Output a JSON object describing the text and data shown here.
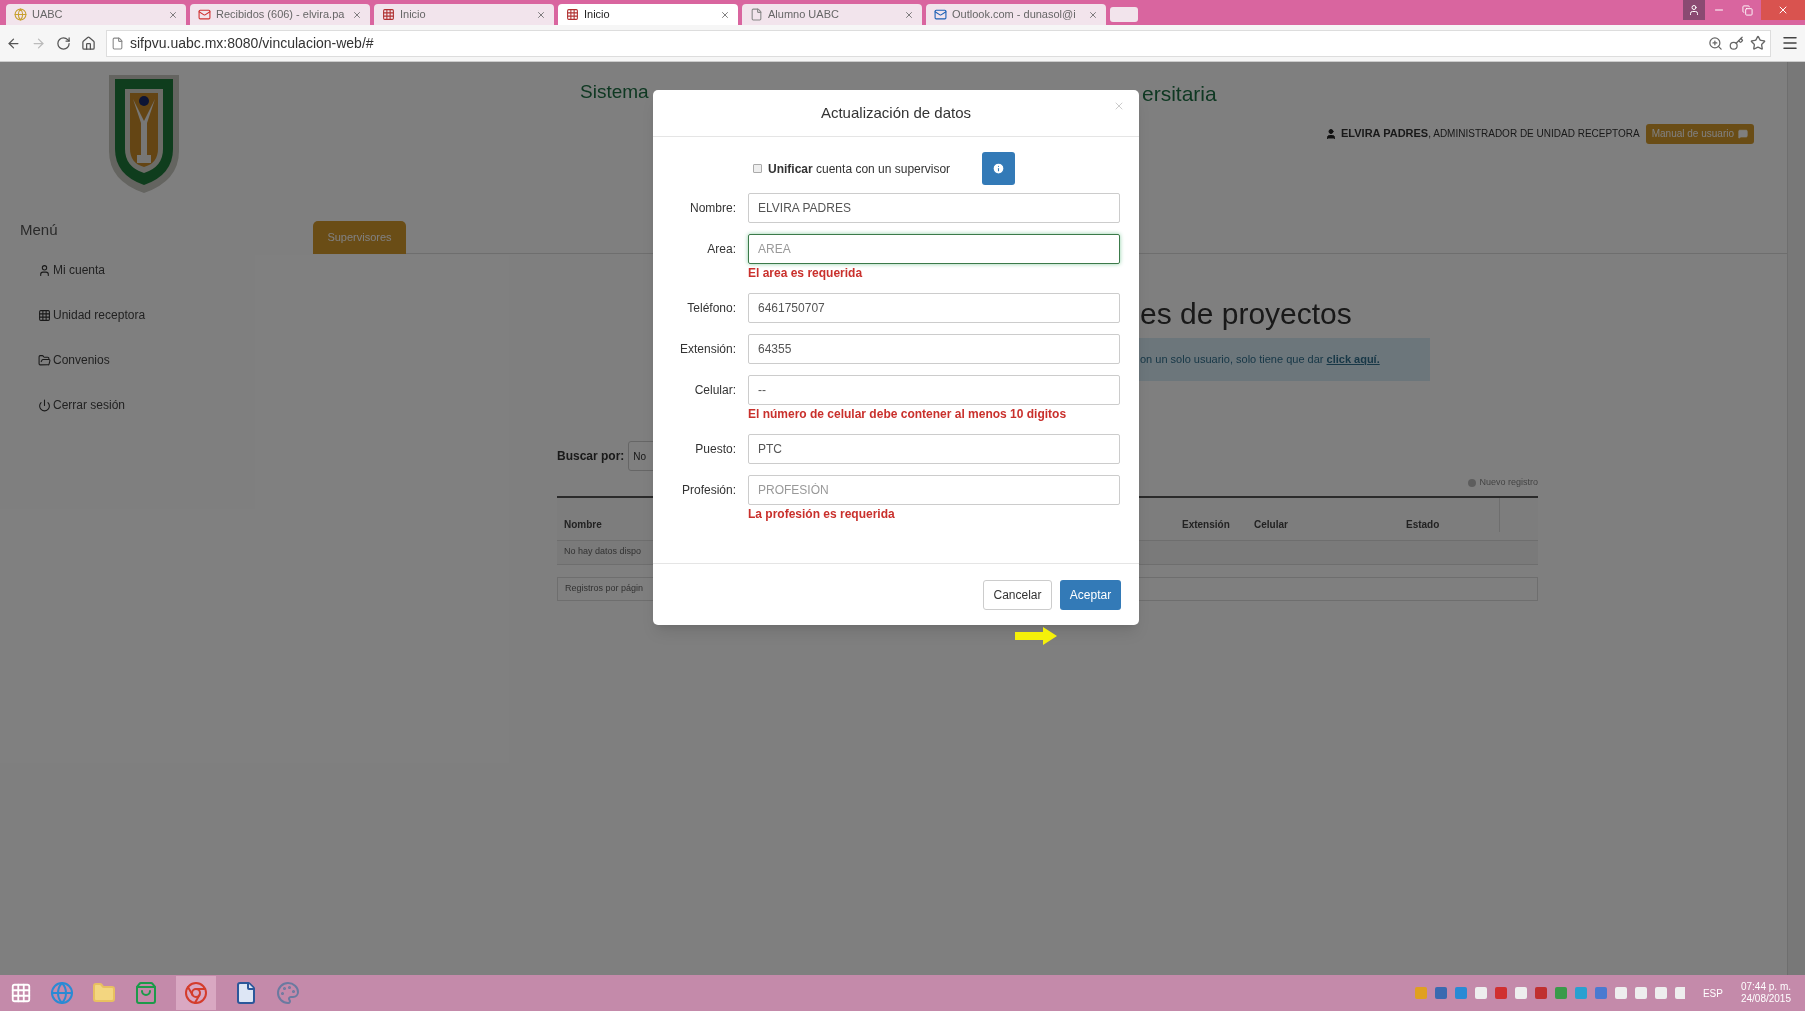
{
  "browser": {
    "tabs": [
      {
        "title": "UABC",
        "selected": false
      },
      {
        "title": "Recibidos (606) - elvira.pa",
        "selected": false
      },
      {
        "title": "Inicio",
        "selected": false
      },
      {
        "title": "Inicio",
        "selected": true
      },
      {
        "title": "Alumno UABC",
        "selected": false
      },
      {
        "title": "Outlook.com - dunasol@i",
        "selected": false
      }
    ],
    "url": "sifpvu.uabc.mx:8080/vinculacion-web/#"
  },
  "header": {
    "title_left": "Sistema",
    "title_right": "ersitaria",
    "user_name": "ELVIRA PADRES",
    "user_role": ", ADMINISTRADOR DE UNIDAD RECEPTORA",
    "manual_button": "Manual de usuario"
  },
  "menu": {
    "title": "Menú",
    "items": [
      {
        "label": "Mi cuenta"
      },
      {
        "label": "Unidad receptora"
      },
      {
        "label": "Convenios"
      },
      {
        "label": "Cerrar sesión"
      }
    ]
  },
  "page_tabs": [
    {
      "label": "Supervisores",
      "selected": true
    }
  ],
  "heading": "es de proyectos",
  "info": {
    "text": "on un solo usuario, solo tiene que dar",
    "link": "click aquí."
  },
  "search": {
    "label": "Buscar por:",
    "value": "No"
  },
  "new_record": "Nuevo registro",
  "table": {
    "columns": [
      "Nombre",
      "Extensión",
      "Celular",
      "Estado"
    ],
    "empty": "No hay datos dispo",
    "footer": "Registros por págin"
  },
  "modal": {
    "title": "Actualización de datos",
    "unify": {
      "label": "**Unificar** cuenta con un supervisor",
      "checked": false
    },
    "fields": [
      {
        "label": "Nombre:",
        "value": "ELVIRA PADRES",
        "focused": false
      },
      {
        "label": "Area:",
        "placeholder": "AREA",
        "focused": true,
        "error": "El area es requerida"
      },
      {
        "label": "Teléfono:",
        "value": "6461750707",
        "focused": false
      },
      {
        "label": "Extensión:",
        "value": "64355",
        "focused": false
      },
      {
        "label": "Celular:",
        "value": "--",
        "focused": false,
        "error": "El número de celular debe contener al menos 10 digitos"
      },
      {
        "label": "Puesto:",
        "value": "PTC",
        "focused": false
      },
      {
        "label": "Profesión:",
        "placeholder": "PROFESIÓN",
        "focused": false,
        "error": "La profesión es requerida"
      }
    ],
    "cancel": "Cancelar",
    "accept": "Aceptar"
  },
  "taskbar": {
    "language": "ESP",
    "time": "07:44 p. m.",
    "date": "24/08/2015"
  }
}
